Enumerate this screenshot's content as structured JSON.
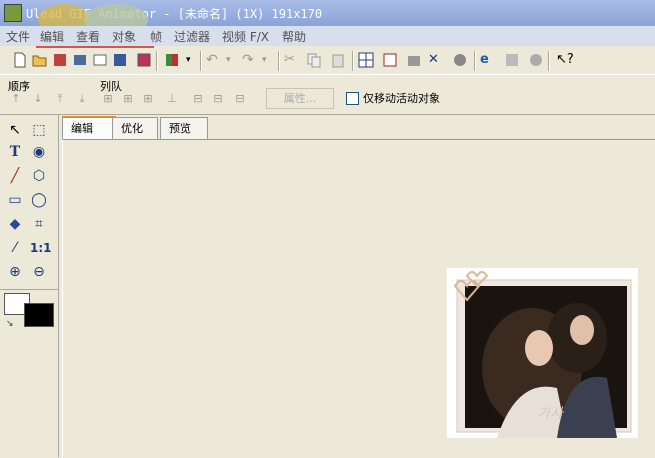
{
  "window": {
    "title": "Ulead GIF Animator - [未命名] (1X) 191x170"
  },
  "menu": [
    "文件",
    "编辑",
    "查看",
    "对象",
    "帧",
    "过滤器",
    "视频 F/X",
    "帮助"
  ],
  "order_panel": {
    "order_label": "顺序",
    "queue_label": "列队",
    "properties_button": "属性...",
    "checkbox_label": "仅移动活动对象"
  },
  "tabs": [
    "编辑",
    "优化",
    "预览"
  ],
  "tools": [
    "pointer-icon",
    "marquee-icon",
    "text-icon",
    "shape-icon",
    "brush-icon",
    "lasso-icon",
    "eraser-icon",
    "ellipse-icon",
    "fill-icon",
    "crop-icon",
    "eyedropper-icon",
    "actual-size-icon",
    "zoom-in-icon",
    "zoom-out-icon"
  ],
  "colors": {
    "foreground": "#ffffff",
    "background": "#000000",
    "accent": "#e68b2c"
  }
}
